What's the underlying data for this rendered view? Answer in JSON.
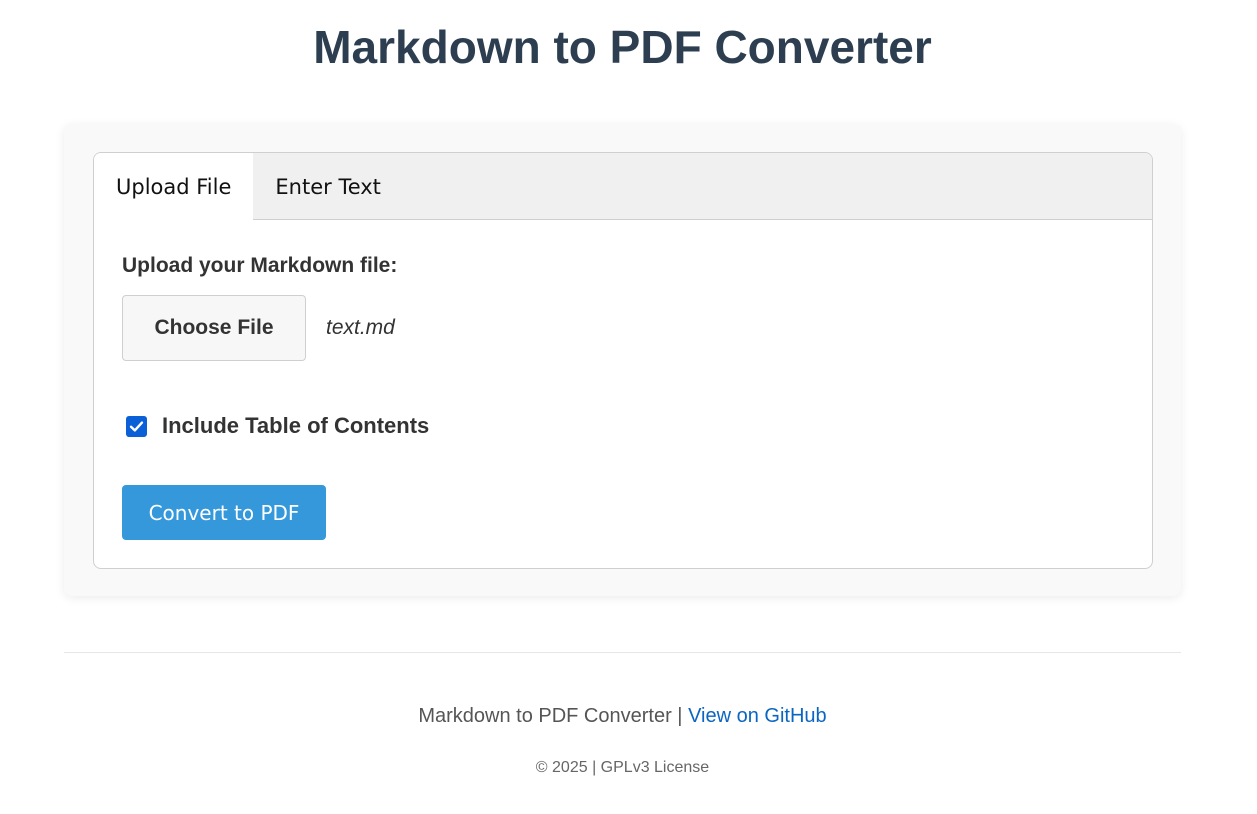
{
  "header": {
    "title": "Markdown to PDF Converter"
  },
  "tabs": [
    {
      "label": "Upload File",
      "active": true
    },
    {
      "label": "Enter Text",
      "active": false
    }
  ],
  "upload": {
    "label": "Upload your Markdown file:",
    "choose_button": "Choose File",
    "file_name": "text.md"
  },
  "options": {
    "toc_label": "Include Table of Contents",
    "toc_checked": true
  },
  "actions": {
    "convert_label": "Convert to PDF"
  },
  "footer": {
    "app_name": "Markdown to PDF Converter",
    "separator": " | ",
    "github_link": "View on GitHub",
    "copyright": "© 2025 | GPLv3 License"
  },
  "colors": {
    "title": "#2c3e50",
    "accent": "#3498db",
    "checkbox": "#0b5fd7",
    "link": "#0a66c2"
  },
  "icons": {
    "checkbox": "checkmark-icon"
  }
}
